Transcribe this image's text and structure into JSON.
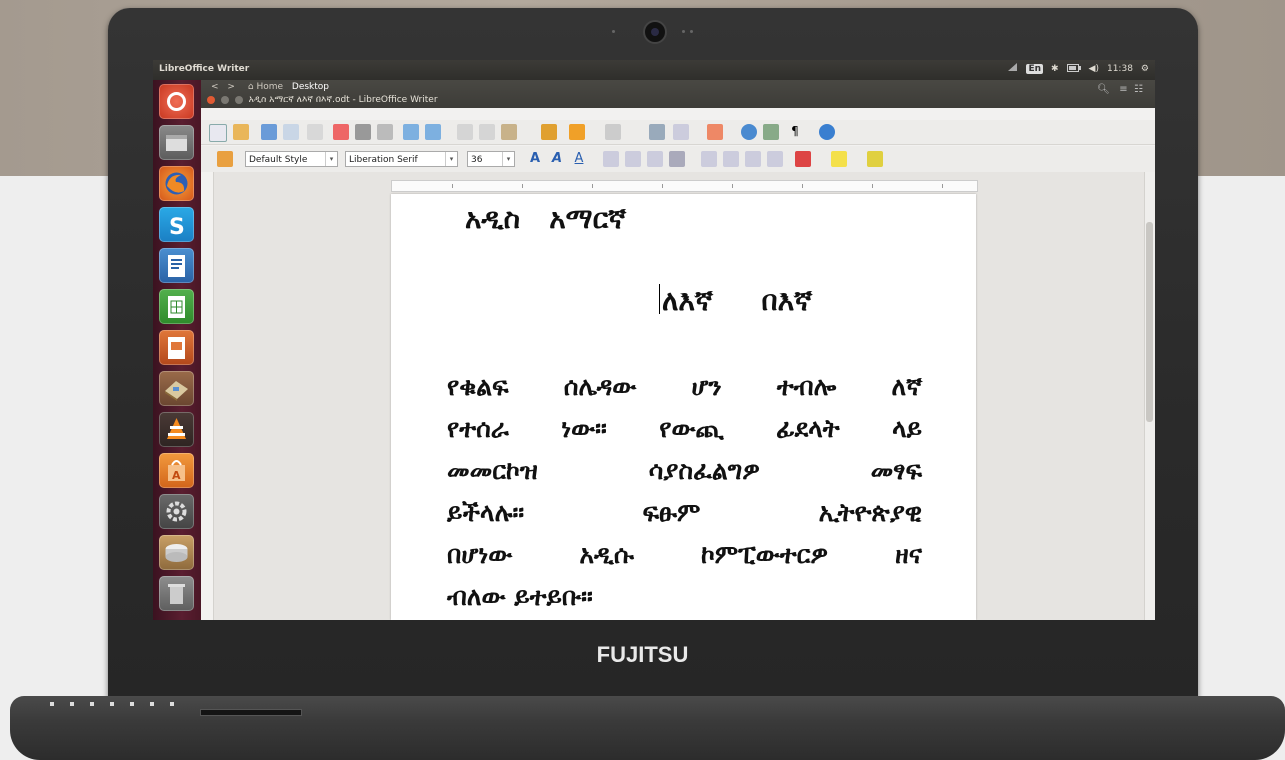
{
  "laptop": {
    "brand": "FUJITSU"
  },
  "system": {
    "app_title": "LibreOffice Writer",
    "keyboard_indicator": "En",
    "clock": "11:38"
  },
  "window": {
    "nav_back": "<",
    "nav_forward": ">",
    "nav_home": "Home",
    "nav_desktop": "Desktop",
    "title": "አዲስ አማርኛ ለእኛ በእኛ.odt - LibreOffice Writer"
  },
  "formatting": {
    "paragraph_style": "Default Style",
    "font_name": "Liberation Serif",
    "font_size": "36"
  },
  "document": {
    "heading1": "አዲስ   አማርኛ",
    "heading2": "ለእኛ     በእኛ",
    "lines": [
      "የቁልፍ ሰሌዳው ሆን ተብሎ ለኛ",
      "የተሰራ ነው። የውጪ ፊደላት ላይ",
      "መመርኮዝ ሳያስፈልግዎ መፃፍ",
      "ይችላሉ። ፍፁም ኢትዮጵያዊ",
      "በሆነው አዲሱ ኮምፒውተርዎ ዘና",
      "ብለው ይተይቡ።"
    ]
  },
  "icons": {
    "launcher": [
      "ubuntu-dash-icon",
      "file-manager-icon",
      "firefox-icon",
      "skype-icon",
      "writer-icon",
      "calc-icon",
      "impress-icon",
      "usb-creator-icon",
      "vlc-icon",
      "software-center-icon",
      "system-settings-icon",
      "disk-icon"
    ]
  }
}
